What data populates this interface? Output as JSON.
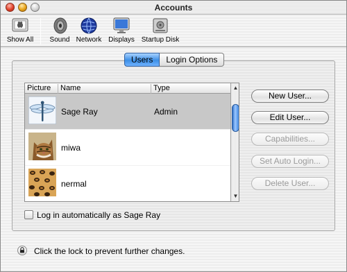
{
  "window": {
    "title": "Accounts"
  },
  "toolbar": {
    "items": [
      {
        "label": "Show All",
        "icon": "apple-prefs-icon"
      },
      {
        "label": "Sound",
        "icon": "speaker-icon"
      },
      {
        "label": "Network",
        "icon": "globe-icon"
      },
      {
        "label": "Displays",
        "icon": "monitor-icon"
      },
      {
        "label": "Startup Disk",
        "icon": "hard-disk-icon"
      }
    ]
  },
  "tabs": [
    {
      "label": "Users",
      "active": true
    },
    {
      "label": "Login Options",
      "active": false
    }
  ],
  "user_list": {
    "columns": [
      "Picture",
      "Name",
      "Type"
    ],
    "rows": [
      {
        "picture": "dragonfly-icon",
        "name": "Sage Ray",
        "type": "Admin",
        "selected": true
      },
      {
        "picture": "cat-photo",
        "name": "miwa",
        "type": "",
        "selected": false
      },
      {
        "picture": "leopard-pattern",
        "name": "nermal",
        "type": "",
        "selected": false
      }
    ]
  },
  "buttons": {
    "new_user": "New User...",
    "edit_user": "Edit User...",
    "capabilities": "Capabilities...",
    "set_auto_login": "Set Auto Login...",
    "delete_user": "Delete User..."
  },
  "auto_login": {
    "label": "Log in automatically as Sage Ray",
    "checked": false
  },
  "lock": {
    "text": "Click the lock to prevent further changes."
  },
  "colors": {
    "selection": "#c8c8c8",
    "tab_active": "#3d8fe6",
    "scroll_thumb": "#3c85e0"
  }
}
